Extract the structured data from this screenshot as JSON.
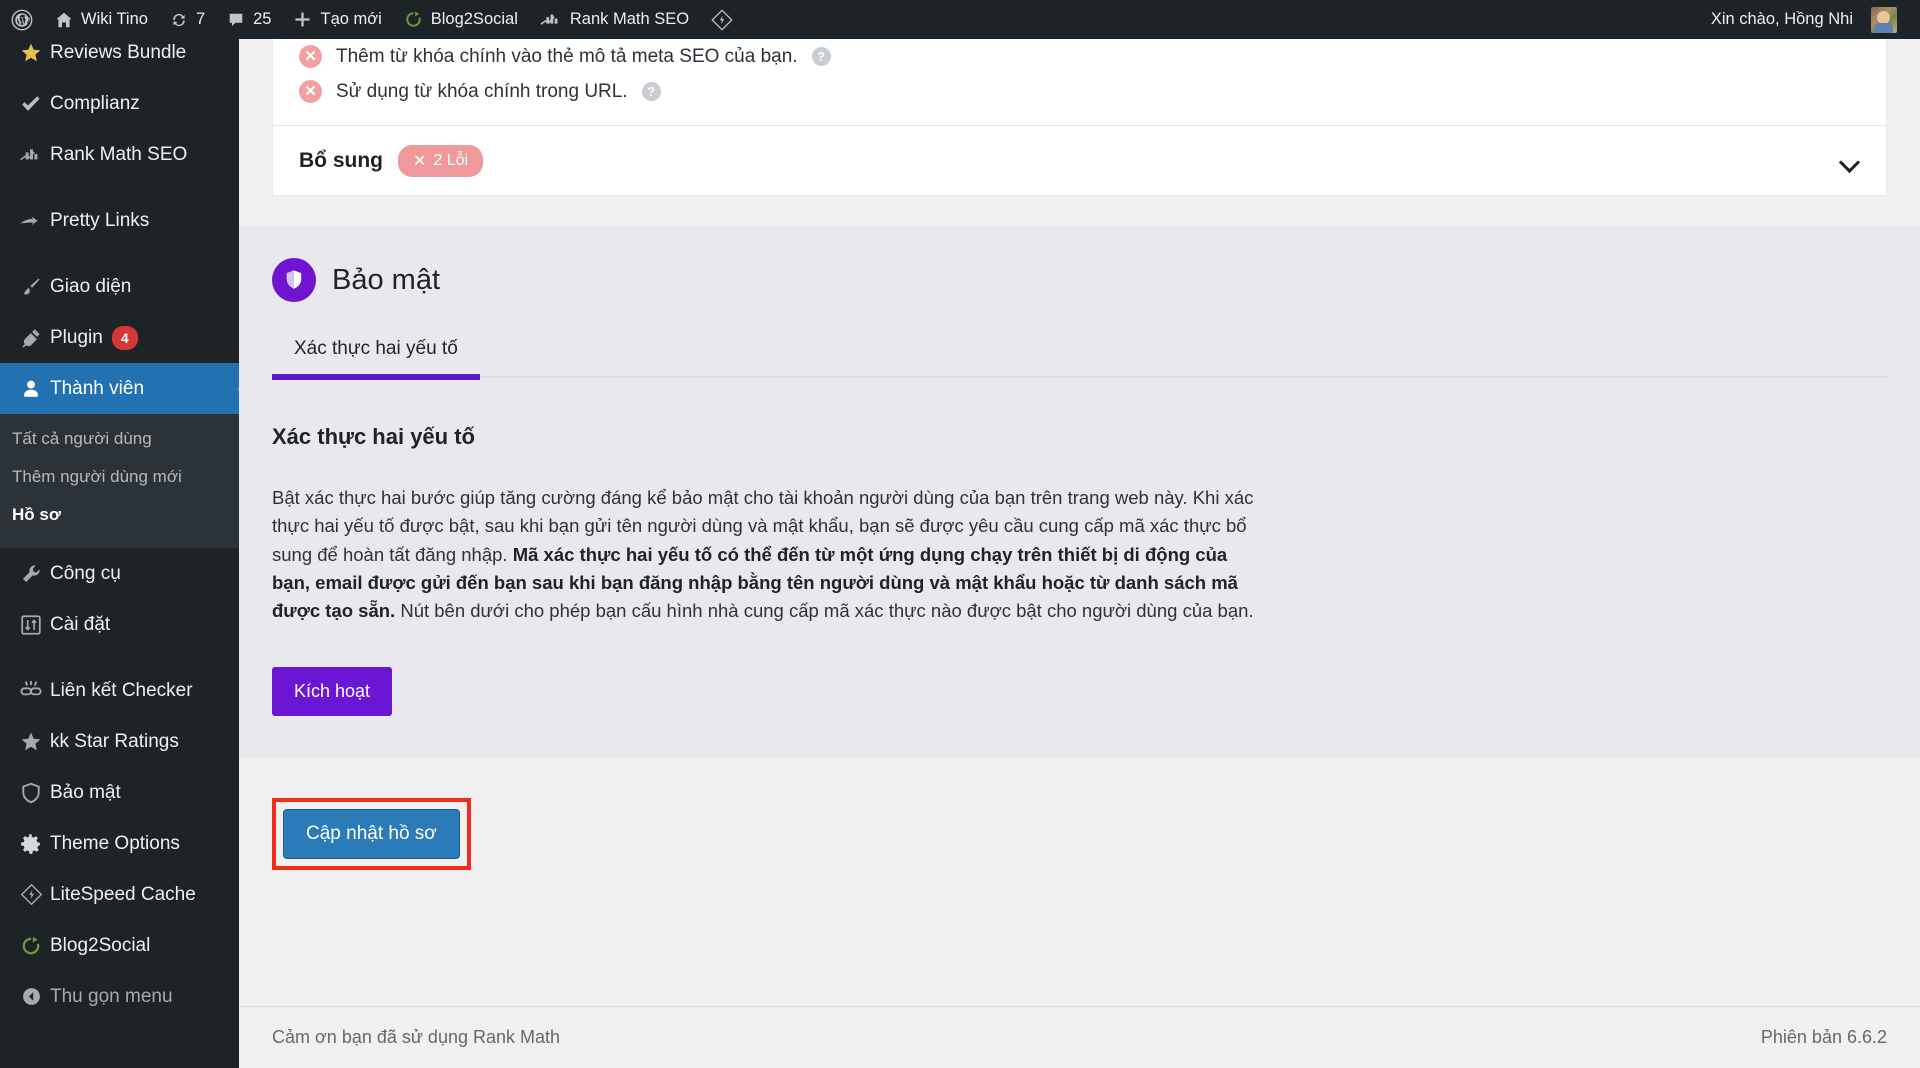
{
  "adminbar": {
    "left_items": [
      {
        "icon": "wordpress-logo-icon",
        "label": ""
      },
      {
        "icon": "home-icon",
        "label": "Wiki Tino"
      },
      {
        "icon": "updates-icon",
        "label": "7"
      },
      {
        "icon": "comment-bubble-icon",
        "label": "25"
      },
      {
        "icon": "plus-icon",
        "label": "Tạo mới"
      },
      {
        "icon": "blog2social-icon",
        "label": "Blog2Social"
      },
      {
        "icon": "rank-math-icon",
        "label": "Rank Math SEO"
      },
      {
        "icon": "litespeed-icon",
        "label": ""
      }
    ],
    "greeting": "Xin chào, Hồng Nhi"
  },
  "sidebar": {
    "items": [
      {
        "icon": "star-icon",
        "label": "Reviews Bundle",
        "badge": "",
        "current": false,
        "gap": false
      },
      {
        "icon": "check-icon",
        "label": "Complianz",
        "badge": "",
        "current": false,
        "gap": false
      },
      {
        "icon": "rank-math-icon",
        "label": "Rank Math SEO",
        "badge": "",
        "current": false,
        "gap": false
      },
      {
        "icon": "link-arrow-icon",
        "label": "Pretty Links",
        "badge": "",
        "current": false,
        "gap": true
      },
      {
        "icon": "brush-icon",
        "label": "Giao diện",
        "badge": "",
        "current": false,
        "gap": true
      },
      {
        "icon": "plug-icon",
        "label": "Plugin",
        "badge": "4",
        "current": false,
        "gap": false
      },
      {
        "icon": "user-icon",
        "label": "Thành viên",
        "badge": "",
        "current": true,
        "gap": false
      }
    ],
    "submenu": [
      {
        "label": "Tất cả người dùng",
        "current": false
      },
      {
        "label": "Thêm người dùng mới",
        "current": false
      },
      {
        "label": "Hồ sơ",
        "current": true
      }
    ],
    "items_after": [
      {
        "icon": "wrench-icon",
        "label": "Công cụ",
        "badge": "",
        "current": false,
        "gap": false
      },
      {
        "icon": "settings-sliders-icon",
        "label": "Cài đặt",
        "badge": "",
        "current": false,
        "gap": false
      },
      {
        "icon": "broken-link-icon",
        "label": "Liên kết Checker",
        "badge": "",
        "current": false,
        "gap": true
      },
      {
        "icon": "star-icon",
        "label": "kk Star Ratings",
        "badge": "",
        "current": false,
        "gap": false
      },
      {
        "icon": "shield-icon",
        "label": "Bảo mật",
        "badge": "",
        "current": false,
        "gap": false
      },
      {
        "icon": "gear-icon",
        "label": "Theme Options",
        "badge": "",
        "current": false,
        "gap": false
      },
      {
        "icon": "litespeed-icon",
        "label": "LiteSpeed Cache",
        "badge": "",
        "current": false,
        "gap": false
      },
      {
        "icon": "blog2social-icon",
        "label": "Blog2Social",
        "badge": "",
        "current": false,
        "gap": false
      }
    ],
    "collapse": {
      "icon": "collapse-arrow-icon",
      "label": "Thu gọn menu"
    }
  },
  "seo_card": {
    "checks": [
      {
        "status_icon": "error-x-icon",
        "text": "Thêm từ khóa chính vào thẻ mô tả meta SEO của bạn.",
        "help_icon": "help-icon"
      },
      {
        "status_icon": "error-x-icon",
        "text": "Sử dụng từ khóa chính trong URL.",
        "help_icon": "help-icon"
      }
    ],
    "footer_title": "Bổ sung",
    "error_pill": "2 Lỗi",
    "error_pill_icon": "x-icon",
    "toggle_icon": "chevron-down-icon"
  },
  "security": {
    "panel_icon": "shield-icon",
    "panel_title": "Bảo mật",
    "tabs": [
      {
        "label": "Xác thực hai yếu tố",
        "active": true
      }
    ],
    "heading": "Xác thực hai yếu tố",
    "paragraph_part1": "Bật xác thực hai bước giúp tăng cường đáng kể bảo mật cho tài khoản người dùng của bạn trên trang web này. Khi xác thực hai yếu tố được bật, sau khi bạn gửi tên người dùng và mật khẩu, bạn sẽ được yêu cầu cung cấp mã xác thực bổ sung để hoàn tất đăng nhập. ",
    "paragraph_bold": "Mã xác thực hai yếu tố có thể đến từ một ứng dụng chạy trên thiết bị di động của bạn, email được gửi đến bạn sau khi bạn đăng nhập bằng tên người dùng và mật khẩu hoặc từ danh sách mã được tạo sẵn.",
    "paragraph_part2": " Nút bên dưới cho phép bạn cấu hình nhà cung cấp mã xác thực nào được bật cho người dùng của bạn.",
    "activate_button": "Kích hoạt",
    "accent_color": "#6b16d4"
  },
  "submit": {
    "update_profile_button": "Cập nhật hồ sơ",
    "highlight_color": "#f02d1c"
  },
  "footer": {
    "left": "Cảm ơn bạn đã sử dụng Rank Math",
    "right": "Phiên bản 6.6.2"
  }
}
